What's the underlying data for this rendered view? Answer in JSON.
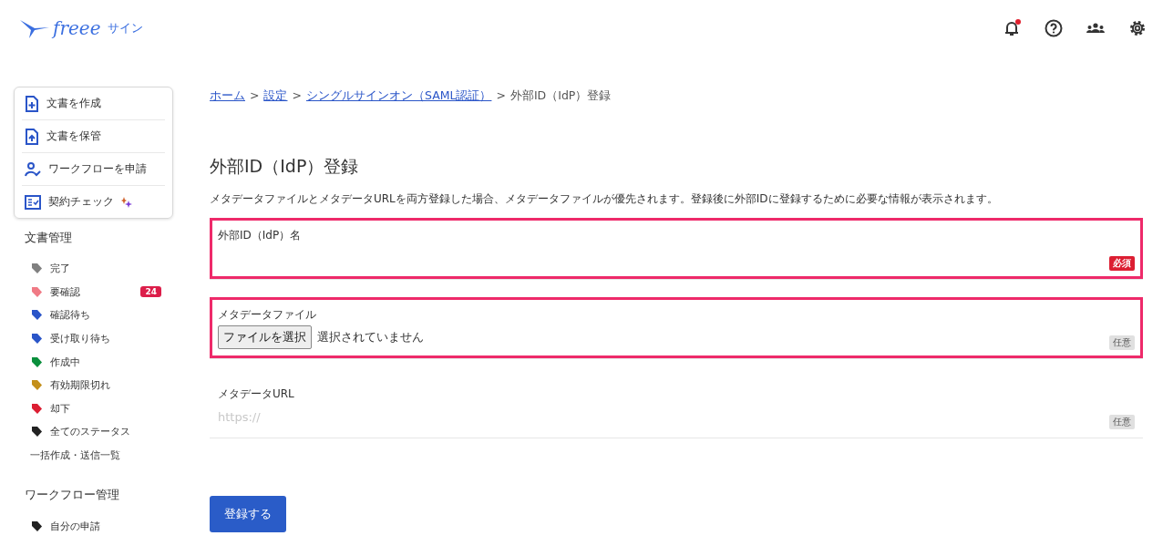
{
  "header": {
    "logo_text": "freee",
    "logo_suffix": "サイン",
    "notification_unread": true
  },
  "quick_actions": [
    {
      "label": "文書を作成",
      "sparkle": false
    },
    {
      "label": "文書を保管",
      "sparkle": false
    },
    {
      "label": "ワークフローを申請",
      "sparkle": false
    },
    {
      "label": "契約チェック",
      "sparkle": true
    }
  ],
  "sidebar_sections": [
    {
      "title": "文書管理",
      "items": [
        {
          "label": "完了",
          "color": "#808080"
        },
        {
          "label": "要確認",
          "color": "#f07a85",
          "count": "24"
        },
        {
          "label": "確認待ち",
          "color": "#2a55c8"
        },
        {
          "label": "受け取り待ち",
          "color": "#2a55c8"
        },
        {
          "label": "作成中",
          "color": "#0a8f3c"
        },
        {
          "label": "有効期限切れ",
          "color": "#c38f1a"
        },
        {
          "label": "却下",
          "color": "#dc1e32"
        },
        {
          "label": "全てのステータス",
          "color": "#222222"
        },
        {
          "label": "一括作成・送信一覧"
        }
      ]
    },
    {
      "title": "ワークフロー管理",
      "items": [
        {
          "label": "自分の申請",
          "color": "#222222"
        }
      ]
    }
  ],
  "breadcrumb": [
    {
      "label": "ホーム",
      "link": true
    },
    {
      "label": "設定",
      "link": true
    },
    {
      "label": "シングルサインオン（SAML認証）",
      "link": true
    },
    {
      "label": "外部ID（IdP）登録",
      "link": false
    }
  ],
  "breadcrumb_separator": ">",
  "page_title": "外部ID（IdP）登録",
  "description": "メタデータファイルとメタデータURLを両方登録した場合、メタデータファイルが優先されます。登録後に外部IDに登録するために必要な情報が表示されます。",
  "fields": [
    {
      "kind": "text",
      "label": "外部ID（IdP）名",
      "badge": "必須",
      "required": true,
      "highlighted": true
    },
    {
      "kind": "file",
      "label": "メタデータファイル",
      "button": "ファイルを選択",
      "status": "選択されていません",
      "badge": "任意",
      "required": false,
      "highlighted": true
    },
    {
      "kind": "text",
      "label": "メタデータURL",
      "placeholder": "https://",
      "badge": "任意",
      "required": false,
      "highlighted": false
    }
  ],
  "submit_button": "登録する"
}
